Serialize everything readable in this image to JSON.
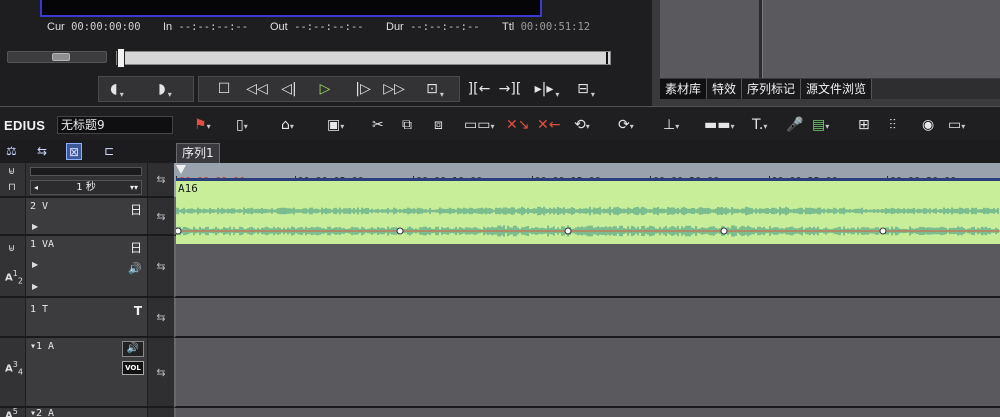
{
  "preview": {
    "cur_label": "Cur",
    "cur_value": "00:00:00:00",
    "in_label": "In",
    "in_value": "--:--:--:--",
    "out_label": "Out",
    "out_value": "--:--:--:--",
    "dur_label": "Dur",
    "dur_value": "--:--:--:--",
    "ttl_label": "Ttl",
    "ttl_value": "00:00:51:12"
  },
  "right_panel": {
    "tabs": [
      "素材库",
      "特效",
      "序列标记",
      "源文件浏览"
    ]
  },
  "toolbar": {
    "logo": "EDIUS",
    "project_name": "无标题9"
  },
  "timeline": {
    "sequence_tab": "序列1",
    "zoom_value": "1 秒",
    "ruler_ticks": [
      "00:00:00:00",
      "00:00:05:00",
      "00:00:10:00",
      "00:00:15:00",
      "00:00:20:00",
      "00:00:25:00",
      "00:00:30:00"
    ],
    "tracks": [
      {
        "name": "2 V"
      },
      {
        "name": "1 VA"
      },
      {
        "name": "1 T"
      },
      {
        "name": "▾1 A"
      },
      {
        "name": "▾2 A"
      }
    ],
    "track_symbols": {
      "video": "日",
      "title": "T"
    },
    "vol_label": "VOL",
    "clip_name": "A16"
  },
  "colors": {
    "clip_fill": "#c8ee9a",
    "waveform": "#5aa88a",
    "ruler_bg": "#9aa3ad",
    "track_bg": "#5a5a5e",
    "play_icon": "#9ee05a"
  },
  "icons": [
    "mark-in-icon",
    "mark-out-icon",
    "stop-icon",
    "rewind-icon",
    "step-back-icon",
    "play-icon",
    "step-forward-icon",
    "fast-forward-icon",
    "loop-icon",
    "scissors-icon",
    "copy-icon",
    "mic-icon",
    "mixer-icon",
    "title-icon"
  ]
}
